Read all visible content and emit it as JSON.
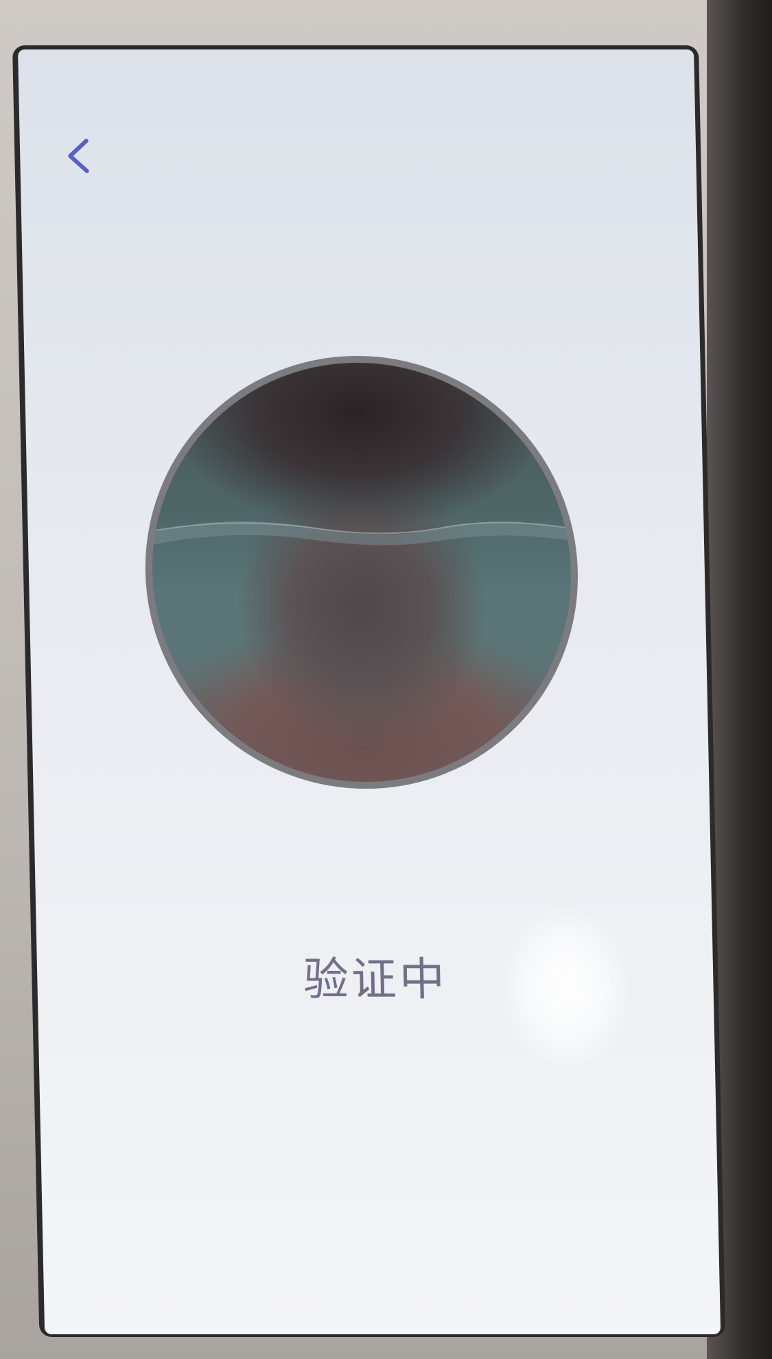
{
  "navigation": {
    "back_icon": "chevron-left-icon",
    "back_color": "#5a5fc8"
  },
  "face_capture": {
    "ring_color": "#7c7b80",
    "status_text": "验证中"
  },
  "colors": {
    "screen_background": "#e9ecf1",
    "status_text": "#707088"
  }
}
